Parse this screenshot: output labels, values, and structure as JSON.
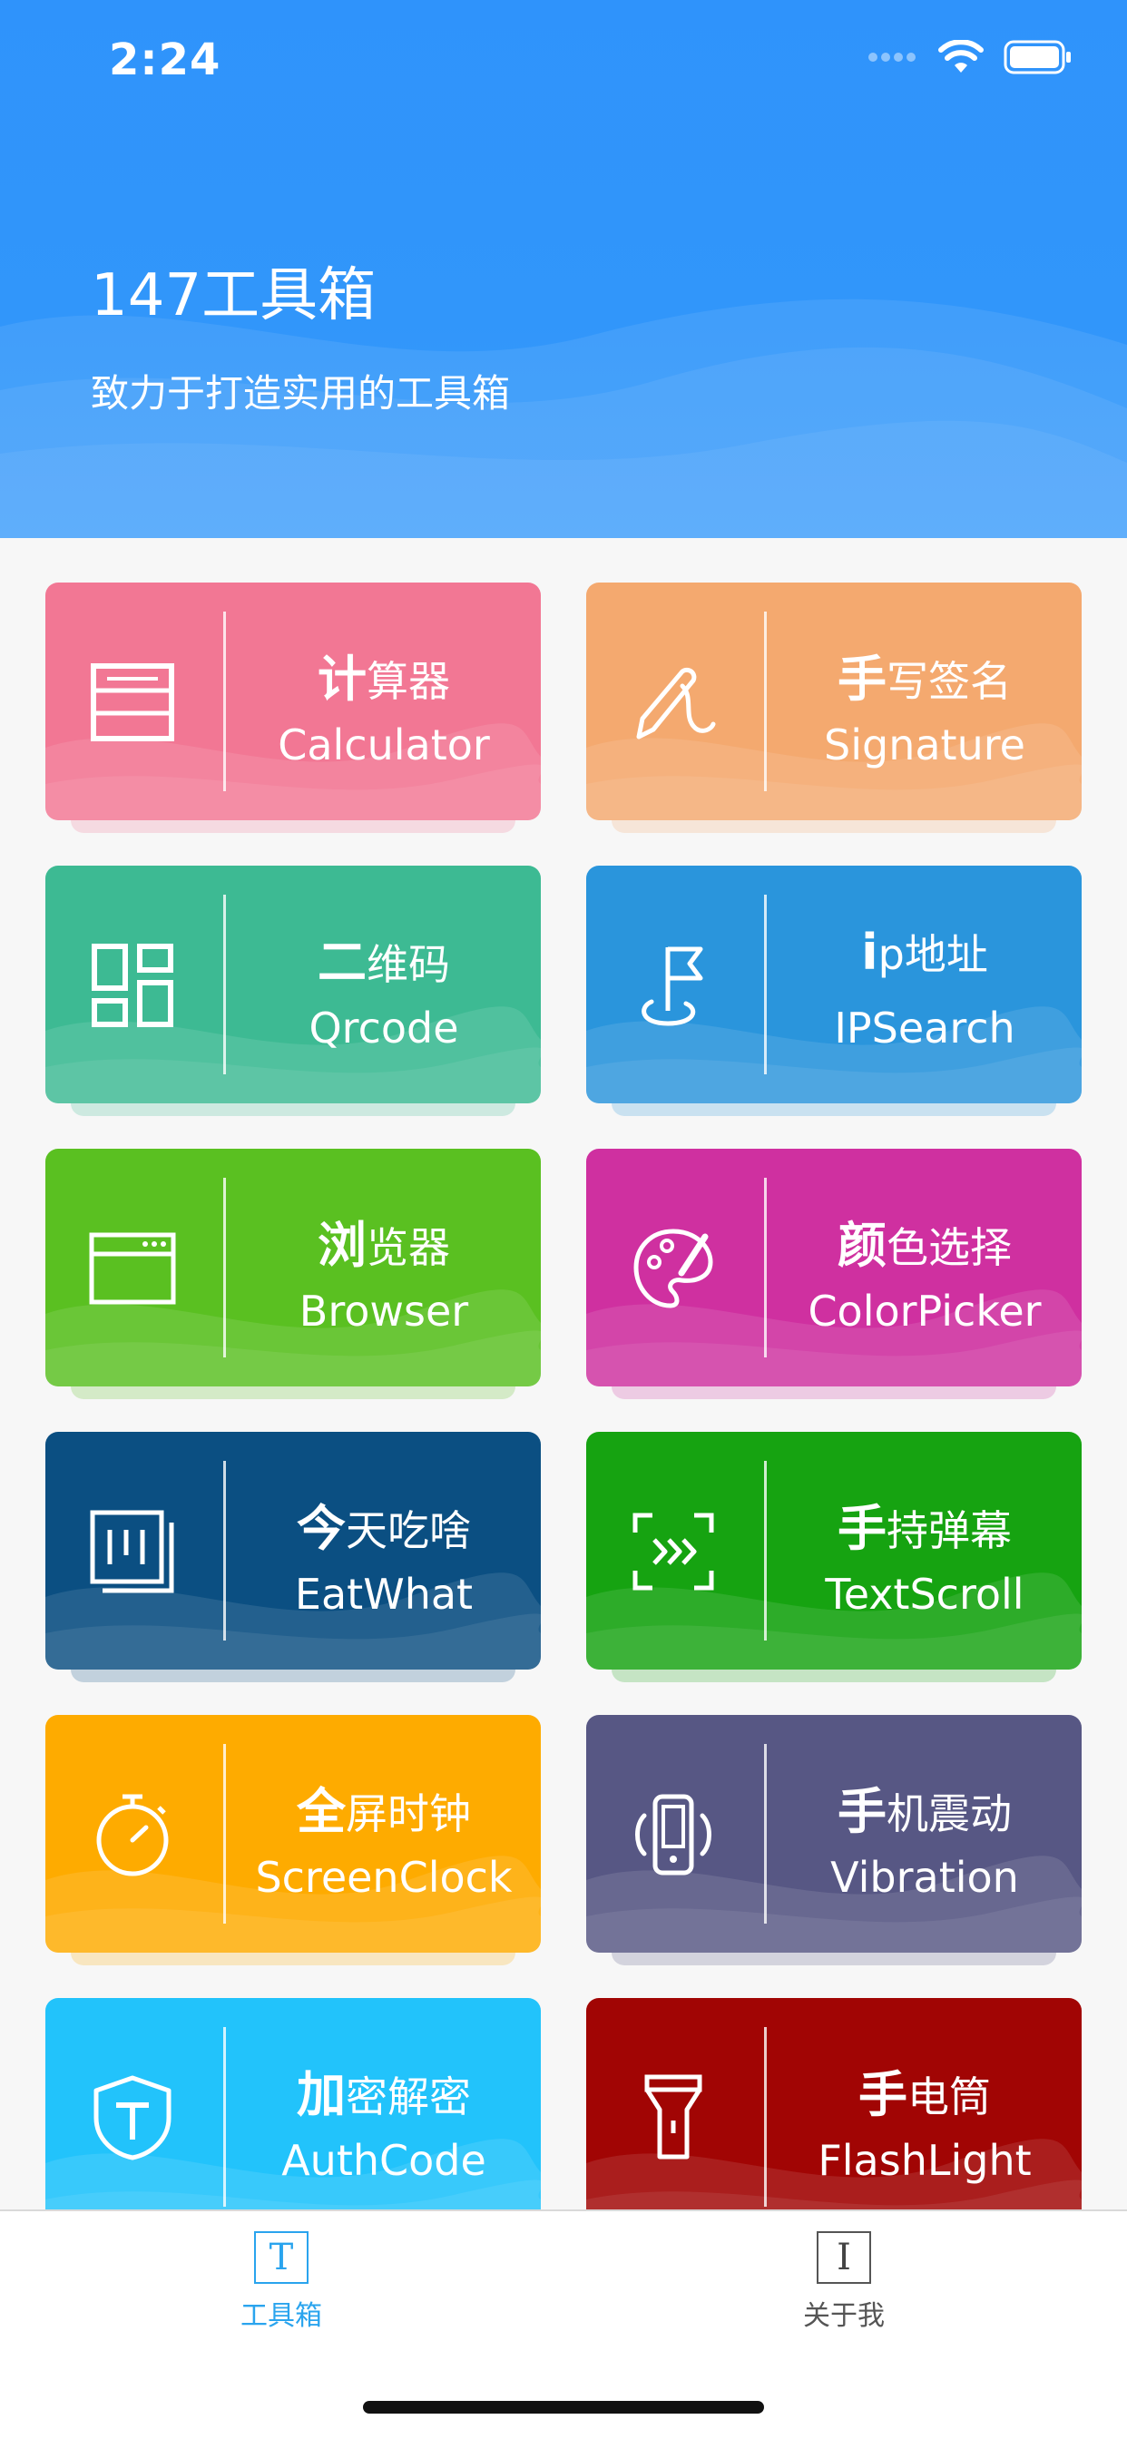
{
  "status_bar": {
    "time": "2:24"
  },
  "header": {
    "title": "147工具箱",
    "subtitle": "致力于打造实用的工具箱"
  },
  "tools": [
    {
      "cn_first": "计",
      "cn_rest": "算器",
      "en": "Calculator",
      "color": "#f27794",
      "icon": "calculator-icon"
    },
    {
      "cn_first": "手",
      "cn_rest": "写签名",
      "en": "Signature",
      "color": "#f4a96f",
      "icon": "pen-icon"
    },
    {
      "cn_first": "二",
      "cn_rest": "维码",
      "en": "Qrcode",
      "color": "#3dba93",
      "icon": "qrcode-icon"
    },
    {
      "cn_first": "i",
      "cn_rest": "p地址",
      "en": "IPSearch",
      "color": "#2a95dc",
      "icon": "flag-pin-icon"
    },
    {
      "cn_first": "浏",
      "cn_rest": "览器",
      "en": "Browser",
      "color": "#5ac021",
      "icon": "browser-icon"
    },
    {
      "cn_first": "颜",
      "cn_rest": "色选择",
      "en": "ColorPicker",
      "color": "#cf30a0",
      "icon": "palette-icon"
    },
    {
      "cn_first": "今",
      "cn_rest": "天吃啥",
      "en": "EatWhat",
      "color": "#0b4f82",
      "icon": "cards-icon"
    },
    {
      "cn_first": "手",
      "cn_rest": "持弹幕",
      "en": "TextScroll",
      "color": "#16a311",
      "icon": "scroll-text-icon"
    },
    {
      "cn_first": "全",
      "cn_rest": "屏时钟",
      "en": "ScreenClock",
      "color": "#feab00",
      "icon": "stopwatch-icon"
    },
    {
      "cn_first": "手",
      "cn_rest": "机震动",
      "en": "Vibration",
      "color": "#575784",
      "icon": "vibration-icon"
    },
    {
      "cn_first": "加",
      "cn_rest": "密解密",
      "en": "AuthCode",
      "color": "#22c3fb",
      "icon": "shield-icon"
    },
    {
      "cn_first": "手",
      "cn_rest": "电筒",
      "en": "FlashLight",
      "color": "#a10504",
      "icon": "flashlight-icon"
    }
  ],
  "tabbar": {
    "tabs": [
      {
        "label": "工具箱",
        "glyph": "T",
        "active": true,
        "color": "#2aa4ee"
      },
      {
        "label": "关于我",
        "glyph": "I",
        "active": false,
        "color": "#555555"
      }
    ]
  }
}
